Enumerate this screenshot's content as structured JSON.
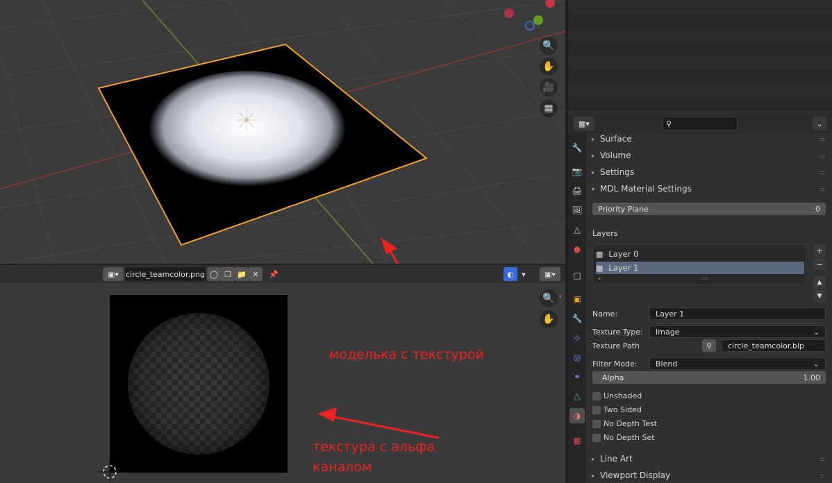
{
  "image_editor": {
    "image_name": "circle_teamcolor.png"
  },
  "annotations": {
    "model_text": "моделька с текстурой",
    "texture_text_line1": "текстура с альфа",
    "texture_text_line2": "каналом"
  },
  "properties": {
    "search_placeholder": "",
    "panels": {
      "surface": "Surface",
      "volume": "Volume",
      "settings": "Settings",
      "mdl": "MDL Material Settings",
      "line_art": "Line Art",
      "viewport_display": "Viewport Display"
    },
    "priority_plane": {
      "label": "Priority Plane",
      "value": "0"
    },
    "layers_label": "Layers",
    "layers": [
      {
        "name": "Layer 0",
        "selected": false
      },
      {
        "name": "Layer 1",
        "selected": true
      }
    ],
    "name_label": "Name:",
    "name_value": "Layer 1",
    "texture_type_label": "Texture Type:",
    "texture_type_value": "Image",
    "texture_path_label": "Texture Path",
    "texture_path_value": "circle_teamcolor.blp",
    "filter_mode_label": "Filter Mode:",
    "filter_mode_value": "Blend",
    "alpha_label": "Alpha",
    "alpha_value": "1.00",
    "checkboxes": {
      "unshaded": "Unshaded",
      "two_sided": "Two Sided",
      "no_depth_test": "No Depth Test",
      "no_depth_set": "No Depth Set"
    }
  },
  "colors": {
    "accent_orange": "#f0a030",
    "annotation_red": "#ee2222",
    "selected_row": "#5a6a7c",
    "active_tab": "#505050"
  }
}
